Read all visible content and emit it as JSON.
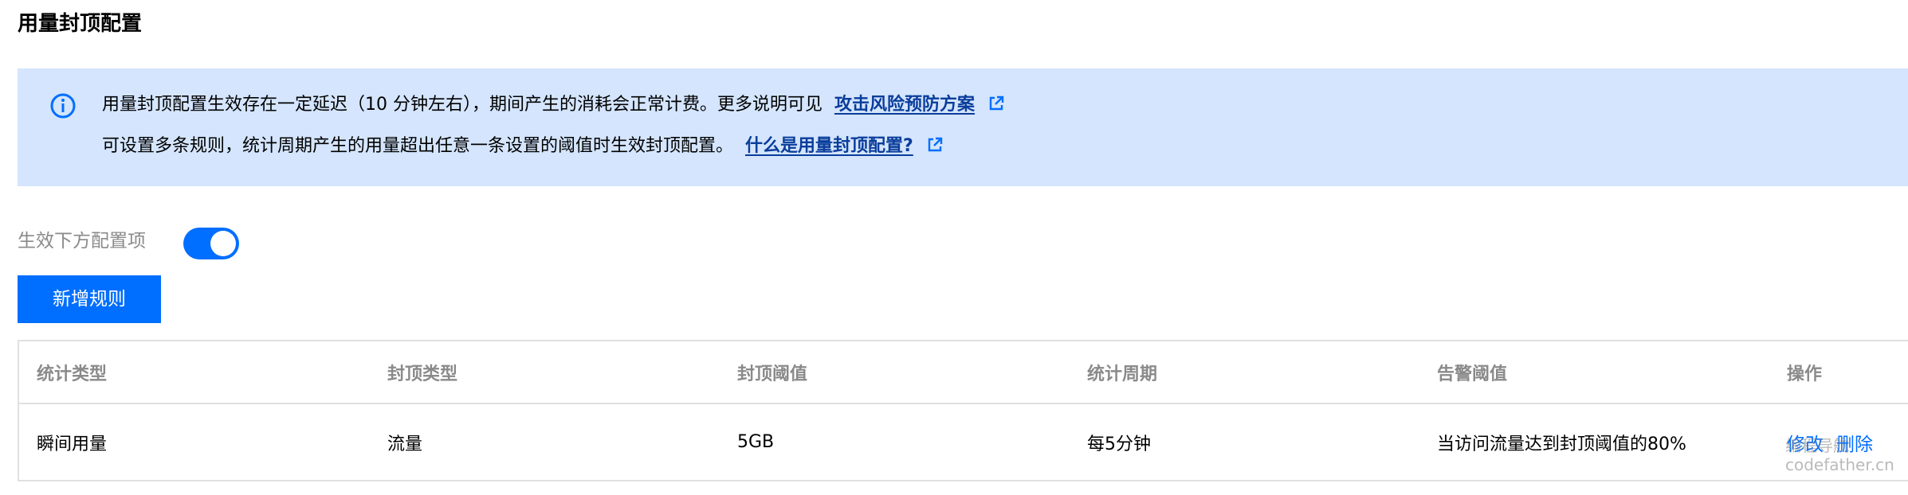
{
  "page": {
    "title": "用量封顶配置"
  },
  "notice": {
    "line1_text": "用量封顶配置生效存在一定延迟（10 分钟左右），期间产生的消耗会正常计费。更多说明可见",
    "line1_link": "攻击风险预防方案",
    "line2_text": "可设置多条规则，统计周期产生的用量超出任意一条设置的阈值时生效封顶配置。",
    "line2_link": "什么是用量封顶配置?",
    "icon": "info-icon",
    "link_icon": "external-link-icon"
  },
  "toggle": {
    "label": "生效下方配置项",
    "enabled": true
  },
  "add_button": {
    "label": "新增规则"
  },
  "table": {
    "columns": [
      "统计类型",
      "封顶类型",
      "封顶阈值",
      "统计周期",
      "告警阈值",
      "操作"
    ],
    "rows": [
      {
        "stat_type": "瞬间用量",
        "cap_type": "流量",
        "threshold": "5GB",
        "period": "每5分钟",
        "alert": "当访问流量达到封顶阈值的80%",
        "edit_label": "修改",
        "delete_label": "删除"
      }
    ]
  },
  "watermark": {
    "line1": "编程导航",
    "line2": "codefather.cn"
  },
  "colors": {
    "primary": "#006eff",
    "notice_bg": "#d4e5fd",
    "link_dark": "#0a3d9b",
    "muted_text": "#8a8a8a",
    "border": "#e0e0e0"
  }
}
